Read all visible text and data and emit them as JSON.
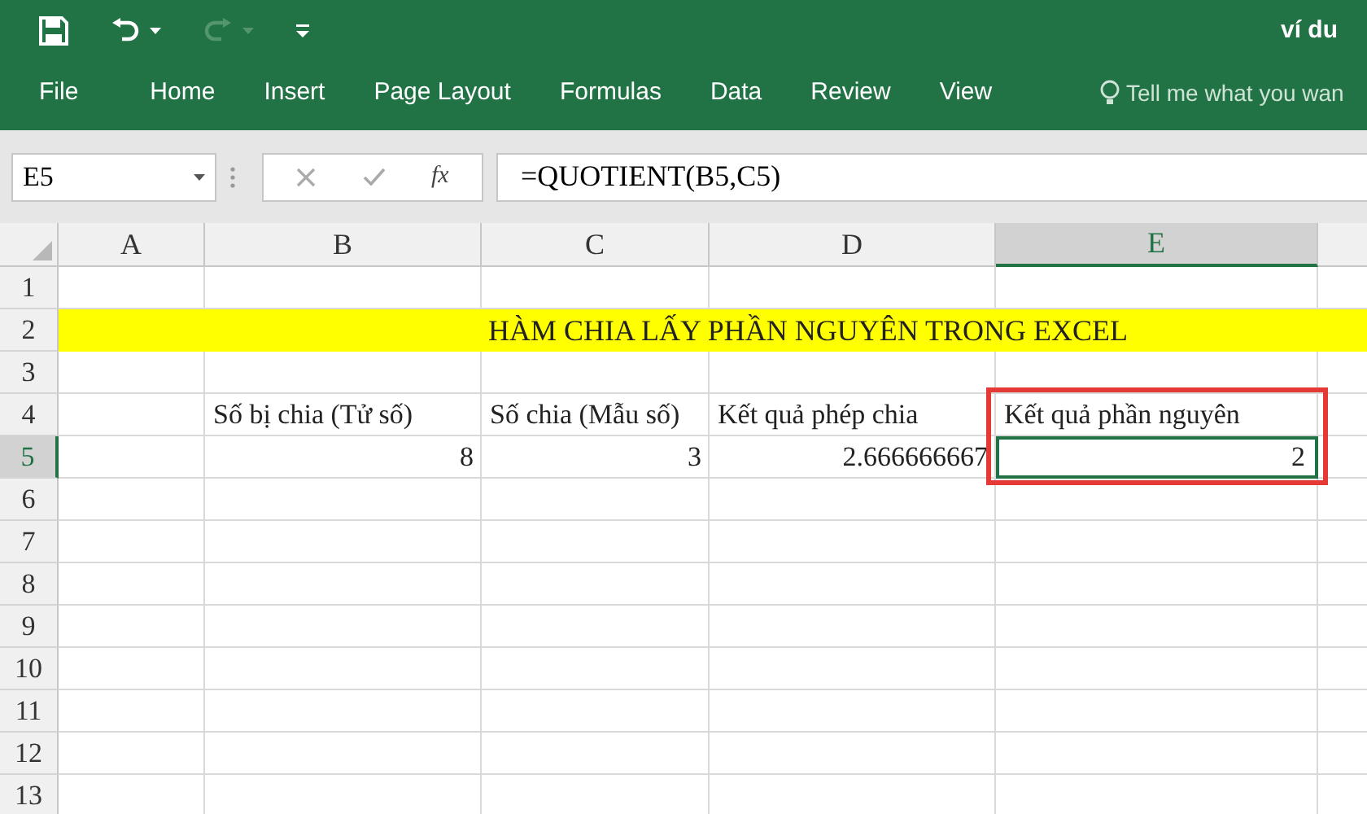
{
  "window": {
    "title": "ví du"
  },
  "ribbon_tabs": [
    {
      "label": "File",
      "selected": false
    },
    {
      "label": "Home",
      "selected": false
    },
    {
      "label": "Insert",
      "selected": false
    },
    {
      "label": "Page Layout",
      "selected": false
    },
    {
      "label": "Formulas",
      "selected": false
    },
    {
      "label": "Data",
      "selected": false
    },
    {
      "label": "Review",
      "selected": false
    },
    {
      "label": "View",
      "selected": false
    }
  ],
  "tell_me": {
    "placeholder": "Tell me what you wan"
  },
  "name_box": {
    "value": "E5"
  },
  "formula_bar": {
    "fx_label": "fx",
    "value": "=QUOTIENT(B5,C5)"
  },
  "columns": [
    {
      "label": "A",
      "selected": false
    },
    {
      "label": "B",
      "selected": false
    },
    {
      "label": "C",
      "selected": false
    },
    {
      "label": "D",
      "selected": false
    },
    {
      "label": "E",
      "selected": true
    }
  ],
  "rows": [
    {
      "number": "1",
      "selected": false,
      "cells": []
    },
    {
      "number": "2",
      "selected": false,
      "kind": "banner",
      "text": "HÀM CHIA LẤY PHẦN NGUYÊN TRONG EXCEL"
    },
    {
      "number": "3",
      "selected": false,
      "cells": []
    },
    {
      "number": "4",
      "selected": false,
      "cells": [
        {
          "kind": "empty"
        },
        {
          "text": "Số bị chia (Tử số)",
          "kind": "text",
          "selected": false
        },
        {
          "text": "Số chia (Mẫu số)",
          "kind": "text",
          "selected": false
        },
        {
          "text": "Kết quả phép chia",
          "kind": "text",
          "selected": false
        },
        {
          "text": "Kết quả phần nguyên",
          "kind": "text",
          "selected": false
        }
      ]
    },
    {
      "number": "5",
      "selected": true,
      "cells": [
        {
          "kind": "empty"
        },
        {
          "text": "8",
          "kind": "number",
          "selected": false
        },
        {
          "text": "3",
          "kind": "number",
          "selected": false
        },
        {
          "text": "2.666666667",
          "kind": "number",
          "selected": false
        },
        {
          "text": "2",
          "kind": "number",
          "selected": true
        }
      ]
    },
    {
      "number": "6",
      "selected": false,
      "cells": []
    },
    {
      "number": "7",
      "selected": false,
      "cells": []
    },
    {
      "number": "8",
      "selected": false,
      "cells": []
    },
    {
      "number": "9",
      "selected": false,
      "cells": []
    },
    {
      "number": "10",
      "selected": false,
      "cells": []
    },
    {
      "number": "11",
      "selected": false,
      "cells": []
    },
    {
      "number": "12",
      "selected": false,
      "cells": []
    },
    {
      "number": "13",
      "selected": false,
      "cells": []
    }
  ],
  "highlight": {
    "on": true
  }
}
